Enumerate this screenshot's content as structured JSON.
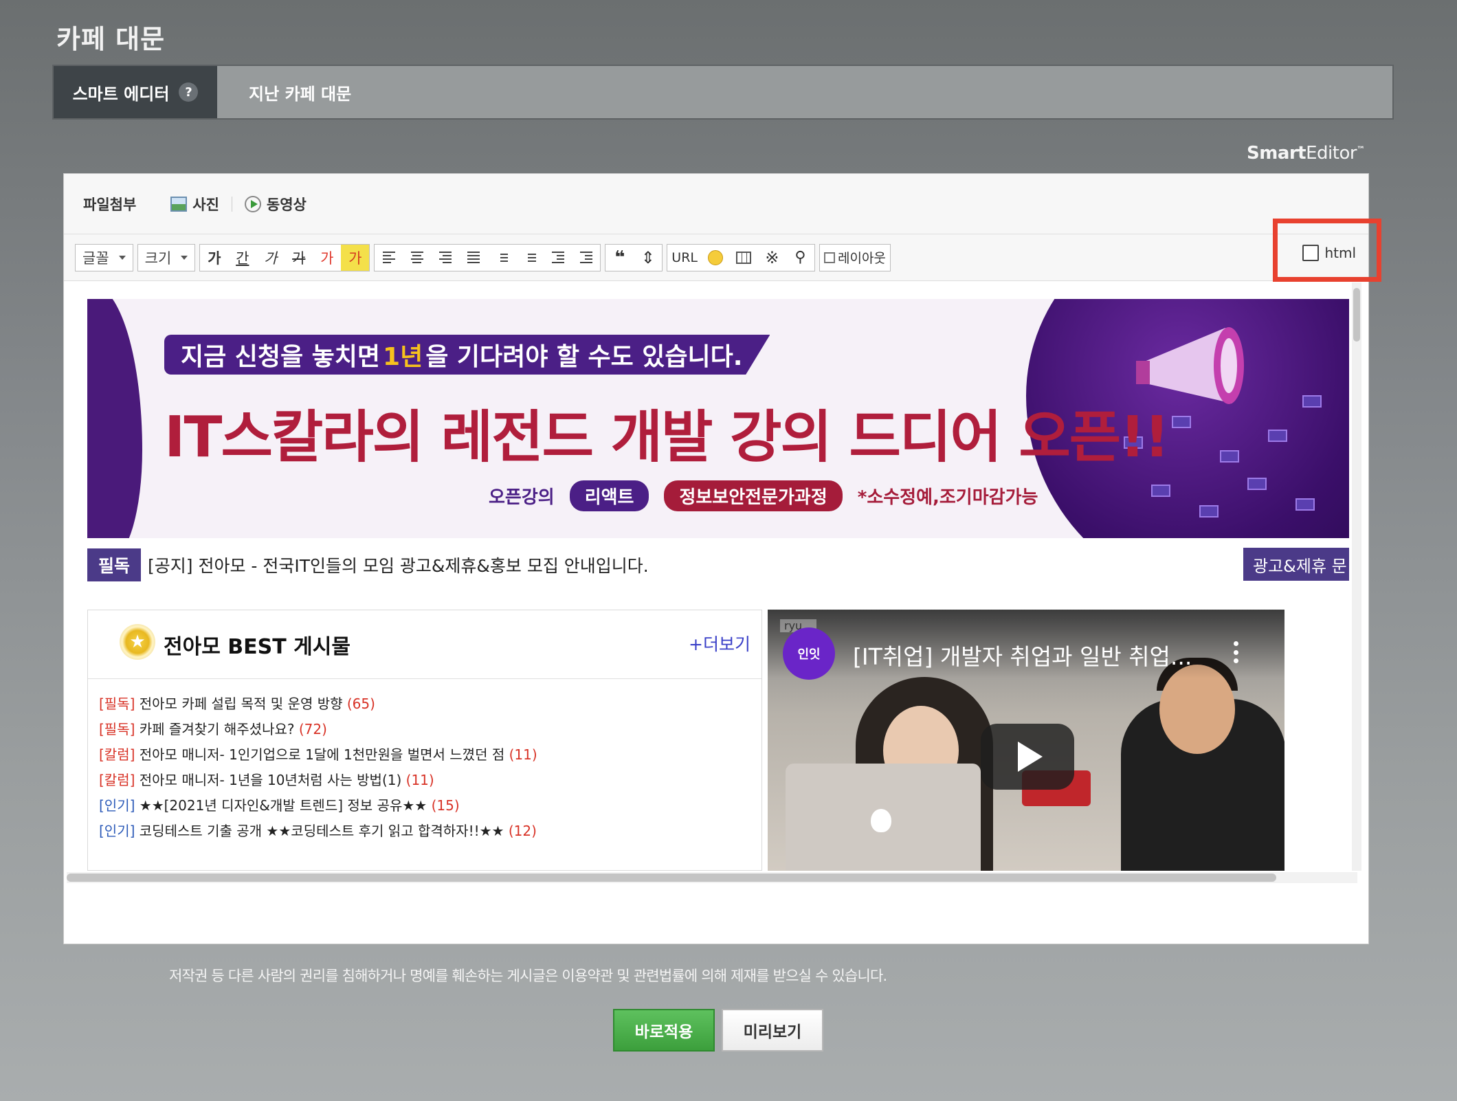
{
  "page": {
    "title": "카페 대문"
  },
  "tabs": [
    {
      "label": "스마트 에디터",
      "active": true,
      "help": "?"
    },
    {
      "label": "지난 카페 대문",
      "active": false
    }
  ],
  "brand": {
    "bold": "Smart",
    "light": "Editor",
    "tm": "™"
  },
  "attach": {
    "label": "파일첨부",
    "photo": "사진",
    "video": "동영상"
  },
  "toolbar": {
    "font": "글꼴",
    "size": "크기",
    "format_buttons": [
      "가",
      "간",
      "가",
      "가",
      "가",
      "가"
    ],
    "url": "URL",
    "layout": "레이아웃",
    "html_label": "html"
  },
  "banner": {
    "tagline_pre": "지금 신청을 놓치면",
    "tagline_hl": "1년",
    "tagline_post": "을 기다려야 할 수도 있습니다.",
    "headline": "IT스칼라의 레전드 개발 강의 드디어 오픈!!",
    "open_label": "오픈강의",
    "pill1": "리액트",
    "pill2": "정보보안전문가과정",
    "note": "*소수정예,조기마감가능"
  },
  "notice": {
    "badge": "필독",
    "text": "[공지] 전아모 - 전국IT인들의 모임 광고&제휴&홍보 모집 안내입니다.",
    "side_button": "광고&제휴 문"
  },
  "best": {
    "title": "전아모 BEST 게시물",
    "more": "+더보기",
    "items": [
      {
        "tag": "[필독]",
        "tag_color": "red",
        "text": " 전아모 카페 설립 목적 및 운영 방향 ",
        "count": "(65)"
      },
      {
        "tag": "[필독]",
        "tag_color": "red",
        "text": " 카페 즐겨찾기 해주셨나요? ",
        "count": "(72)"
      },
      {
        "tag": "[칼럼]",
        "tag_color": "red",
        "text": " 전아모 매니저- 1인기업으로 1달에 1천만원을 벌면서 느꼈던 점 ",
        "count": "(11)"
      },
      {
        "tag": "[칼럼]",
        "tag_color": "red",
        "text": " 전아모 매니저- 1년을 10년처럼 사는 방법(1) ",
        "count": "(11)"
      },
      {
        "tag": "[인기]",
        "tag_color": "blue",
        "text": " ★★[2021년 디자인&개발 트렌드] 정보 공유★★ ",
        "count": "(15)"
      },
      {
        "tag": "[인기]",
        "tag_color": "blue",
        "text": " 코딩테스트 기출 공개 ★★코딩테스트 후기 읽고 합격하자!!★★ ",
        "count": "(12)"
      }
    ]
  },
  "video": {
    "channel": "인잇",
    "title": "[IT취업] 개발자 취업과 일반 취업...",
    "watermark": "ryu..."
  },
  "footer": {
    "legal": "저작권 등 다른 사람의 권리를 침해하거나 명예를 훼손하는 게시글은 이용약관 및 관련법률에 의해 제재를 받으실 수 있습니다.",
    "apply": "바로적용",
    "preview": "미리보기"
  }
}
